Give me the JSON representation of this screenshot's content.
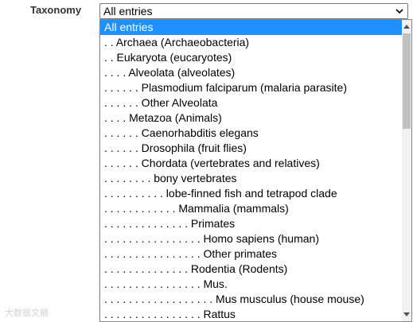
{
  "form": {
    "label": "Taxonomy",
    "selected_value": "All entries"
  },
  "dropdown": {
    "options": [
      "All entries",
      ". . Archaea (Archaeobacteria)",
      ". . Eukaryota (eucaryotes)",
      ". . . . Alveolata (alveolates)",
      ". . . . . . Plasmodium falciparum (malaria parasite)",
      ". . . . . . Other Alveolata",
      ". . . . Metazoa (Animals)",
      ". . . . . . Caenorhabditis elegans",
      ". . . . . . Drosophila (fruit flies)",
      ". . . . . . Chordata (vertebrates and relatives)",
      ". . . . . . . . bony vertebrates",
      ". . . . . . . . . . lobe-finned fish and tetrapod clade",
      ". . . . . . . . . . . . Mammalia (mammals)",
      ". . . . . . . . . . . . . . Primates",
      ". . . . . . . . . . . . . . . . Homo sapiens (human)",
      ". . . . . . . . . . . . . . . . Other primates",
      ". . . . . . . . . . . . . . Rodentia (Rodents)",
      ". . . . . . . . . . . . . . . . Mus.",
      ". . . . . . . . . . . . . . . . . . Mus musculus (house mouse)",
      ". . . . . . . . . . . . . . . . Rattus"
    ],
    "selected_index": 0
  },
  "watermark": "大数据文摘",
  "colors": {
    "highlight": "#1e90ff",
    "label": "#333333"
  },
  "icons": {
    "select_arrow": "chevron-down-icon"
  }
}
